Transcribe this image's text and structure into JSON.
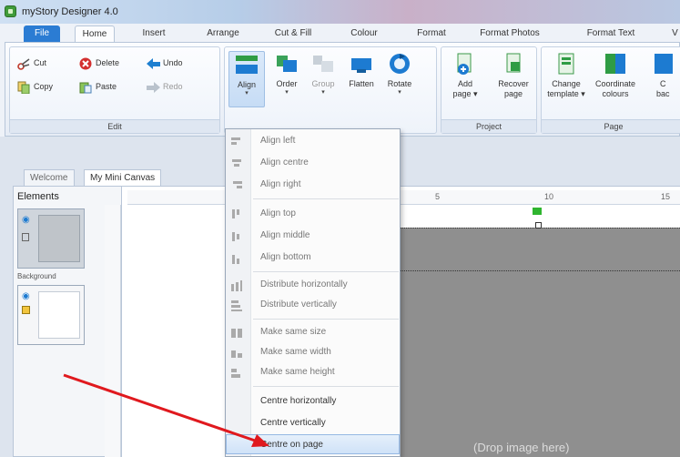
{
  "window": {
    "title": "myStory Designer 4.0"
  },
  "tabs": [
    "File",
    "Home",
    "Insert",
    "Arrange",
    "Cut & Fill",
    "Colour",
    "Format",
    "Format Photos",
    "Format Text",
    "V"
  ],
  "ribbon": {
    "edit": {
      "cut": "Cut",
      "delete": "Delete",
      "undo": "Undo",
      "copy": "Copy",
      "paste": "Paste",
      "redo": "Redo",
      "label": "Edit"
    },
    "arrange": {
      "align": "Align",
      "order": "Order",
      "group": "Group",
      "flatten": "Flatten",
      "rotate": "Rotate"
    },
    "project": {
      "add_page_1": "Add",
      "add_page_2": "page",
      "recover_1": "Recover",
      "recover_2": "page",
      "label": "Project"
    },
    "page": {
      "change_1": "Change",
      "change_2": "template",
      "coord_1": "Coordinate",
      "coord_2": "colours",
      "back_1": "C",
      "back_2": "bac",
      "label": "Page"
    }
  },
  "doc_tabs": [
    "Welcome",
    "My Mini Canvas"
  ],
  "elements": {
    "title": "Elements",
    "background_label": "Background"
  },
  "ruler": {
    "mark_5": "5",
    "mark_10": "10",
    "mark_15": "15"
  },
  "canvas": {
    "drop_text": "(Drop image here)"
  },
  "align_menu": {
    "items": [
      "Align left",
      "Align centre",
      "Align right",
      "Align top",
      "Align middle",
      "Align bottom",
      "Distribute horizontally",
      "Distribute vertically",
      "Make same size",
      "Make same width",
      "Make same height",
      "Centre horizontally",
      "Centre vertically",
      "Centre on page"
    ],
    "highlighted": "Centre on page"
  },
  "colors": {
    "accent": "#2b7cd3",
    "arrow": "#e0191e",
    "highlight": "#cfe2f8"
  }
}
